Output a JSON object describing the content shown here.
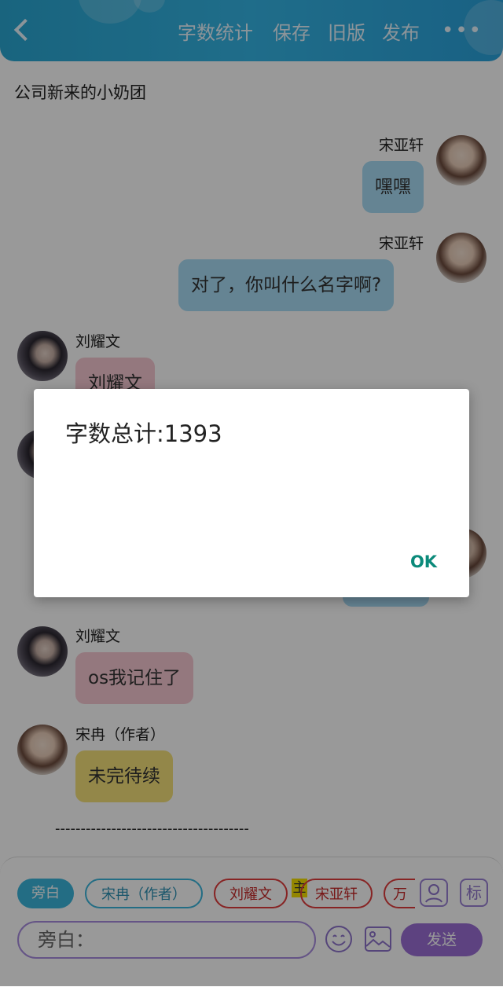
{
  "header": {
    "actions": [
      "字数统计",
      "保存",
      "旧版",
      "发布"
    ],
    "more": "•••"
  },
  "story_title": "公司新来的小奶团",
  "messages": [
    {
      "side": "right",
      "speaker": "宋亚轩",
      "text": "嘿嘿",
      "color": "blue"
    },
    {
      "side": "right",
      "speaker": "宋亚轩",
      "text": "对了，你叫什么名字啊?",
      "color": "blue"
    },
    {
      "side": "left",
      "speaker": "刘耀文",
      "text": "刘耀文",
      "color": "pink"
    },
    {
      "side": "left",
      "speaker": "刘耀文",
      "text": "os我记住了",
      "color": "pink"
    },
    {
      "side": "left",
      "speaker": "宋冉（作者）",
      "text": "未完待续",
      "color": "yellow"
    }
  ],
  "divider": "--------------------------------------",
  "input_bar": {
    "chips": [
      "旁白",
      "宋冉（作者）",
      "刘耀文",
      "宋亚轩",
      "万"
    ],
    "main_badge": "主",
    "mark_button": "标",
    "input_placeholder": "旁白：",
    "send_label": "发送"
  },
  "dialog": {
    "message": "字数总计:1393",
    "ok_label": "OK"
  },
  "colors": {
    "header": "#35b6e6",
    "bubble_blue": "#a9dcf5",
    "bubble_pink": "#f7c9d2",
    "bubble_yellow": "#f6e27b",
    "send": "#9b6fd6",
    "ok_text": "#0b8a7a"
  }
}
